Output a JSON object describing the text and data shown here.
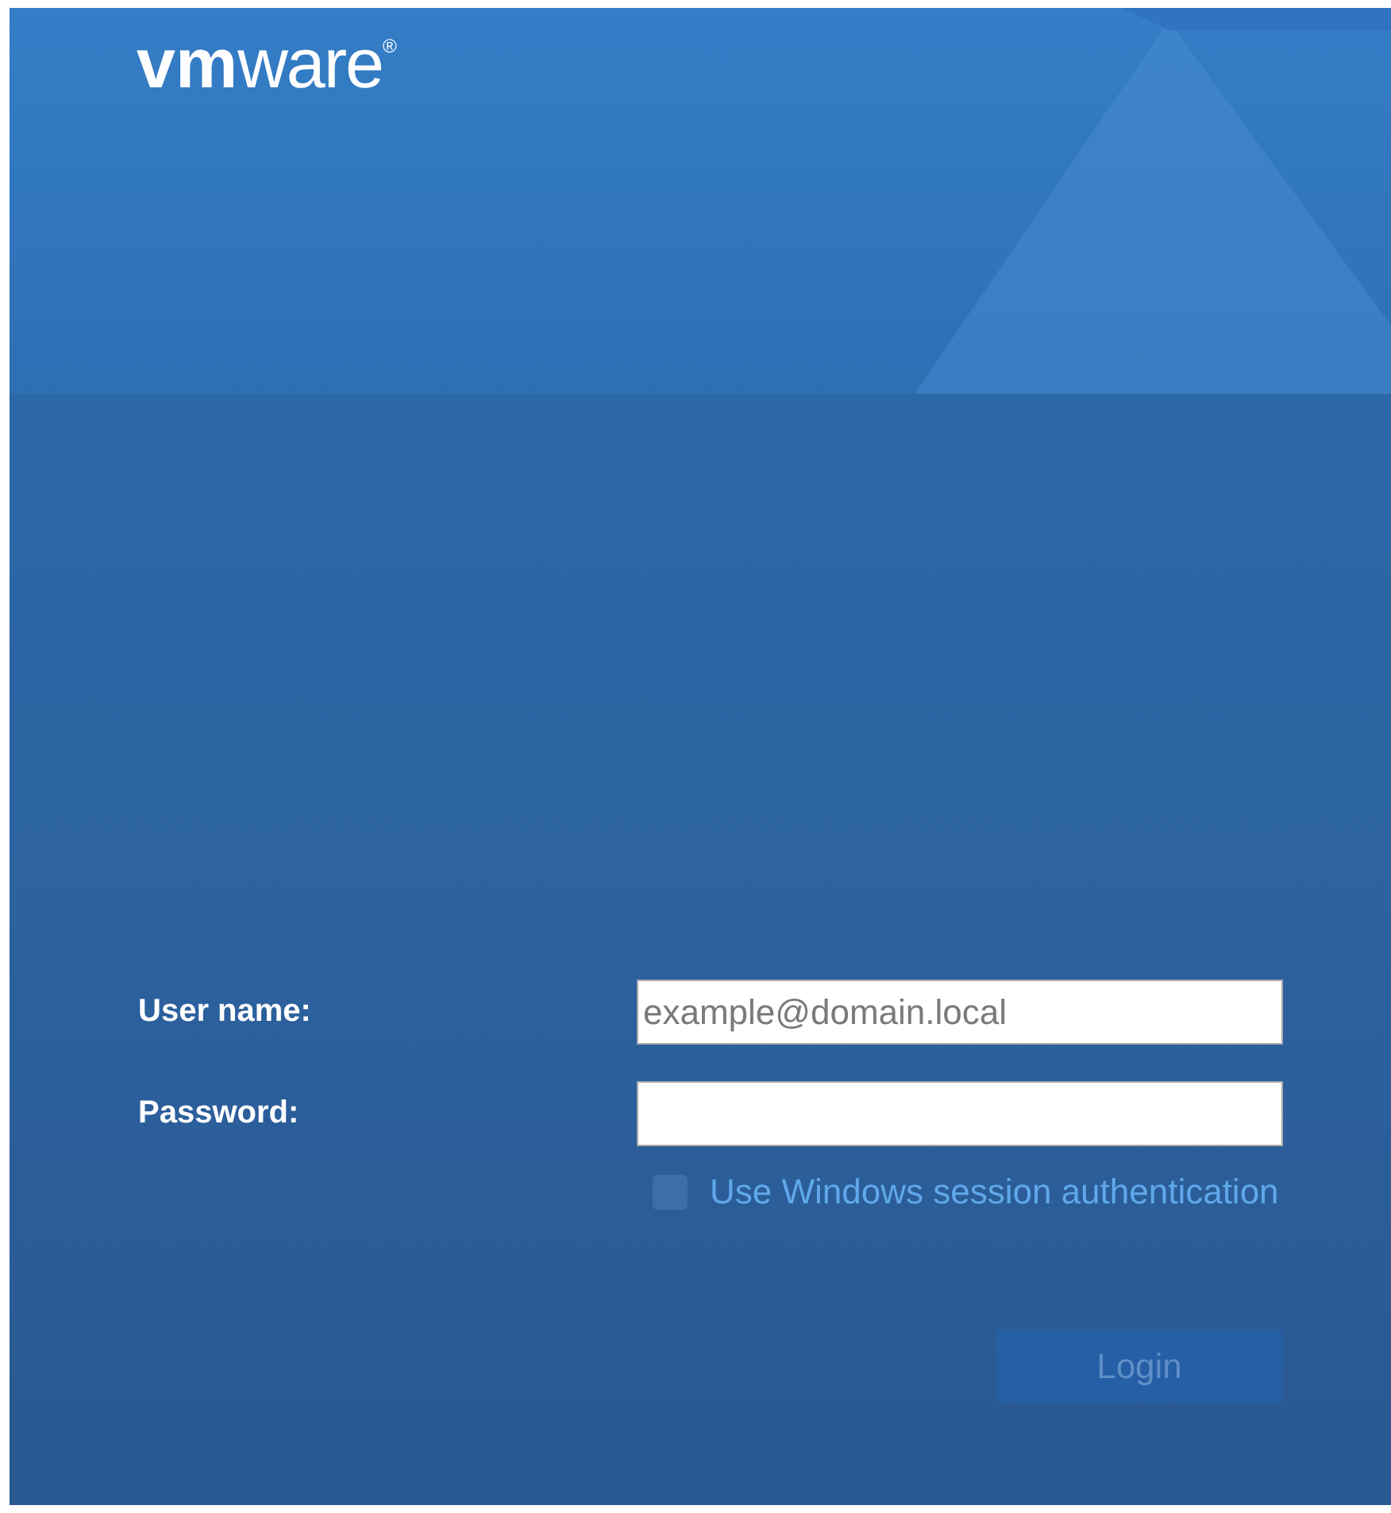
{
  "logo": {
    "text": "**vm**ware$^{®}$"
  },
  "fields": [
    {
      "label": "User name:",
      "placeholder": "example@domain.local"
    },
    {
      "label": "Password:"
    }
  ],
  "windows_session": {
    "label": "Use Windows session authentication",
    "checked": false,
    "disabled": true
  },
  "login_button": {
    "label": "Login",
    "disabled": true
  }
}
